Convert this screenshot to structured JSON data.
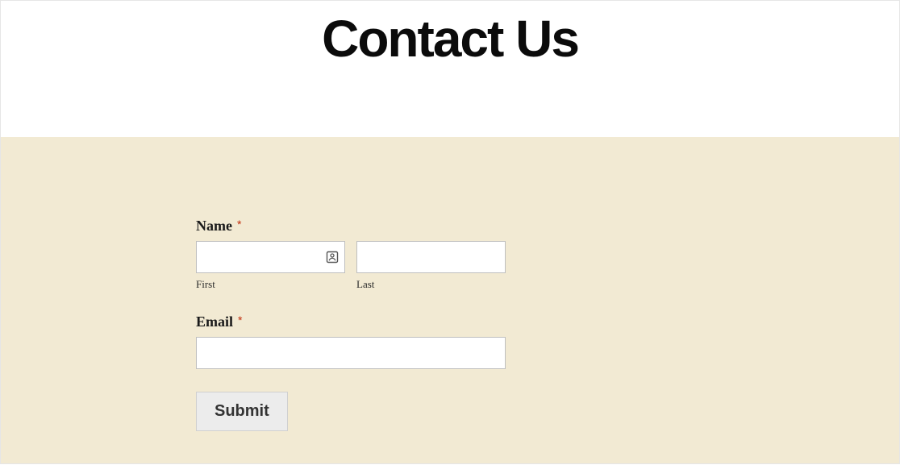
{
  "header": {
    "title": "Contact Us"
  },
  "form": {
    "name": {
      "label": "Name",
      "required_marker": "*",
      "first": {
        "value": "",
        "sublabel": "First"
      },
      "last": {
        "value": "",
        "sublabel": "Last"
      }
    },
    "email": {
      "label": "Email",
      "required_marker": "*",
      "value": ""
    },
    "submit_label": "Submit"
  },
  "colors": {
    "form_background": "#f2ead3",
    "required_marker": "#c02b0a"
  }
}
